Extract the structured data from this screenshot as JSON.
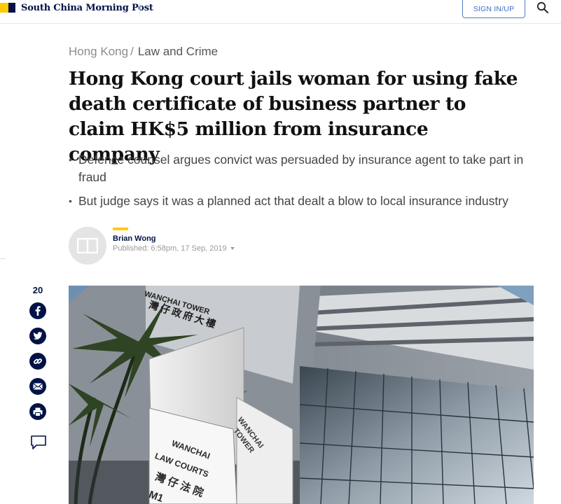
{
  "header": {
    "brand": "South China Morning Post",
    "signin_label": "SIGN IN/UP",
    "search_icon": "search-icon",
    "colors": {
      "brand_navy": "#001246",
      "brand_yellow": "#ffca05",
      "link_blue": "#3a6dc2"
    }
  },
  "breadcrumb": {
    "section": "Hong Kong",
    "separator": "/",
    "subsection": "Law and Crime"
  },
  "article": {
    "headline": "Hong Kong court jails woman for using fake death certificate of business partner to claim HK$5 million from insurance company",
    "summary": [
      "Defence counsel argues convict was persuaded by insurance agent to take part in fraud",
      "But judge says it was a planned act that dealt a blow to local insurance industry"
    ],
    "author": {
      "name": "Brian Wong",
      "published": "Published: 6:58pm, 17 Sep, 2019"
    }
  },
  "share": {
    "count": "20",
    "icons": [
      "facebook-icon",
      "twitter-icon",
      "link-icon",
      "email-icon",
      "print-icon",
      "comment-icon"
    ]
  },
  "hero_image": {
    "signs": {
      "tower_en": "WANCHAI TOWER",
      "tower_zh": "灣仔政府大樓",
      "panel_en_line1": "WANCHAI",
      "panel_en_line2": "TOWER",
      "courts_line1": "WANCHAI",
      "courts_line2": "LAW COURTS",
      "courts_zh": "灣仔法院",
      "courts_code": "M1"
    }
  }
}
